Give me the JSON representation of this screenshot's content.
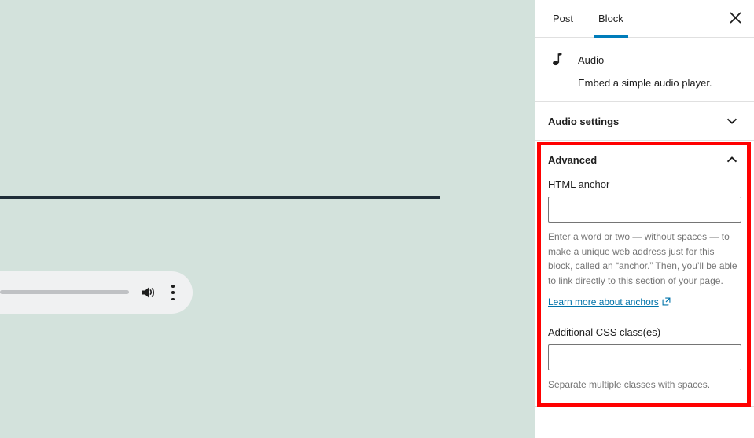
{
  "canvas": {
    "background_color": "#d3e2dc",
    "separator_color": "#1e2d38",
    "audio_player": {
      "name": "audio-player",
      "background_color": "#f0f1f2",
      "progress_color": "#bfc1c4",
      "volume_icon": "speaker-volume-icon",
      "menu_icon": "vertical-kebab-menu-icon"
    }
  },
  "sidebar": {
    "tabs": [
      {
        "label": "Post",
        "active": false
      },
      {
        "label": "Block",
        "active": true
      }
    ],
    "active_tab_color": "#007cba",
    "close_icon": "close-icon",
    "block": {
      "icon": "audio-note-icon",
      "title": "Audio",
      "description": "Embed a simple audio player."
    },
    "panels": [
      {
        "title": "Audio settings",
        "expanded": false,
        "chevron_icon": "chevron-down-icon"
      },
      {
        "title": "Advanced",
        "expanded": true,
        "chevron_icon": "chevron-up-icon",
        "fields": [
          {
            "label": "HTML anchor",
            "value": "",
            "placeholder": "",
            "help": "Enter a word or two — without spaces — to make a unique web address just for this block, called an “anchor.” Then, you’ll be able to link directly to this section of your page.",
            "link": {
              "label": "Learn more about anchors",
              "icon": "external-link-icon",
              "color": "#0073aa"
            }
          },
          {
            "label": "Additional CSS class(es)",
            "value": "",
            "placeholder": "",
            "help": "Separate multiple classes with spaces."
          }
        ]
      }
    ]
  },
  "highlight": {
    "name": "advanced-panel-highlight",
    "color": "#ff0000"
  }
}
